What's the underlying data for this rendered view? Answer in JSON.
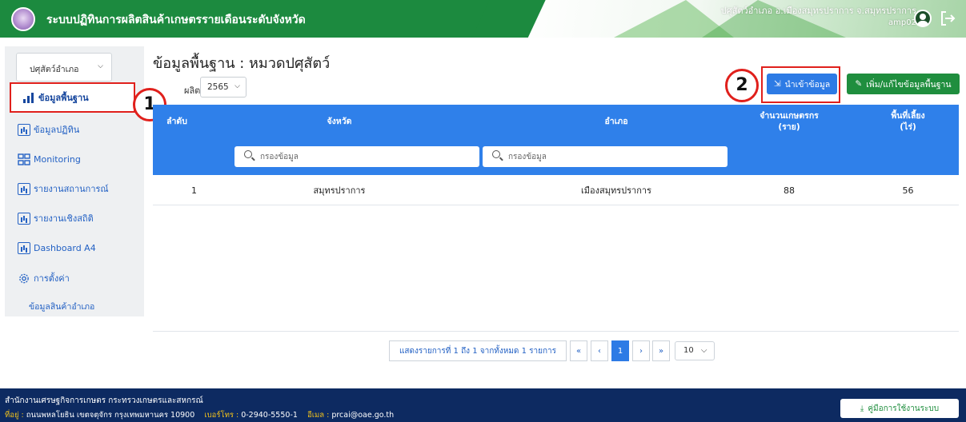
{
  "header": {
    "app_title": "ระบบปฏิทินการผลิตสินค้าเกษตรรายเดือนระดับจังหวัด",
    "user_line": "ปศุสัตว์อำเภอ อ.เมืองสมุทรปราการ จ.สมุทรปราการ",
    "username": "amp02"
  },
  "sidebar": {
    "dropdown_value": "ปศุสัตว์อำเภอ",
    "items": [
      {
        "label": "ข้อมูลพื้นฐาน",
        "icon": "bar-chart-icon",
        "active": true
      },
      {
        "label": "ข้อมูลปฏิทิน",
        "icon": "calendar-chart-icon"
      },
      {
        "label": "Monitoring",
        "icon": "grid-icon"
      },
      {
        "label": "รายงานสถานการณ์",
        "icon": "report-icon"
      },
      {
        "label": "รายงานเชิงสถิติ",
        "icon": "report-icon"
      },
      {
        "label": "Dashboard A4",
        "icon": "report-icon"
      },
      {
        "label": "การตั้งค่า",
        "icon": "gear-icon"
      }
    ],
    "sub_item": "ข้อมูลสินค้าอำเภอ"
  },
  "annotations": {
    "badge1": "1",
    "badge2": "2",
    "highlight_color": "#e0201c"
  },
  "main": {
    "title": "ข้อมูลพื้นฐาน : หมวดปศุสัตว์",
    "year_label": "ผลิต",
    "year_value": "2565",
    "import_button": "นำเข้าข้อมูล",
    "edit_button": "เพิ่ม/แก้ไขข้อมูลพื้นฐาน"
  },
  "table": {
    "columns": [
      "ลำดับ",
      "จังหวัด",
      "อำเภอ",
      "จำนวนเกษตรกร",
      "(ราย)",
      "พื้นที่เลี้ยง",
      "(ไร่)"
    ],
    "filter_placeholder": "กรองข้อมูล",
    "rows": [
      [
        "1",
        "สมุทรปราการ",
        "เมืองสมุทรปราการ",
        "88",
        "56"
      ]
    ]
  },
  "pagination": {
    "info": "แสดงรายการที่ 1 ถึง 1 จากทั้งหมด 1 รายการ",
    "first": "«",
    "prev": "‹",
    "current": "1",
    "next": "›",
    "last": "»",
    "page_size": "10"
  },
  "footer": {
    "org": "สำนักงานเศรษฐกิจการเกษตร กระทรวงเกษตรและสหกรณ์",
    "addr_label": "ที่อยู่ :",
    "addr": "ถนนพหลโยธิน เขตจตุจักร กรุงเทพมหานคร 10900",
    "phone_label": "เบอร์โทร :",
    "phone": "0-2940-5550-1",
    "email_label": "อีเมล :",
    "email": "prcai@oae.go.th",
    "manual_button": "คู่มือการใช้งานระบบ"
  },
  "colors": {
    "header_green": "#1c8a3f",
    "table_blue": "#2f80ea",
    "import_blue": "#2d7be5",
    "edit_green": "#1f8e3e",
    "footer_navy": "#0d2a61"
  }
}
